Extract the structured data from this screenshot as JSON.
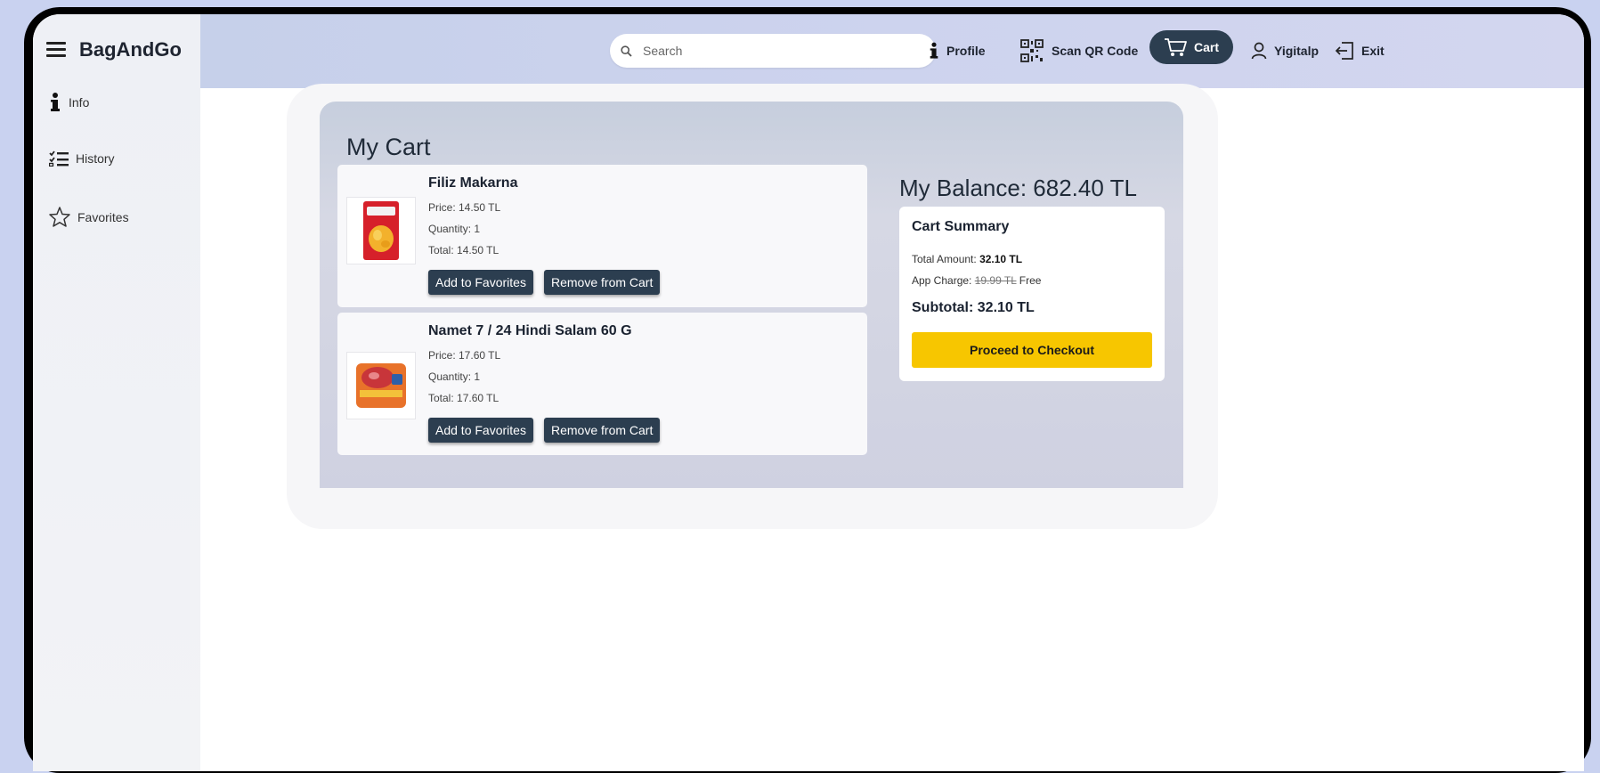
{
  "app": {
    "brand": "BagAndGo"
  },
  "sidebar": {
    "items": [
      {
        "label": "Info"
      },
      {
        "label": "History"
      },
      {
        "label": "Favorites"
      }
    ]
  },
  "topbar": {
    "search_placeholder": "Search",
    "nav": {
      "profile": "Profile",
      "scan": "Scan QR Code",
      "cart": "Cart",
      "user": "Yigitalp",
      "exit": "Exit"
    }
  },
  "cart": {
    "title": "My Cart",
    "items": [
      {
        "name": "Filiz Makarna",
        "price": "Price: 14.50 TL",
        "quantity": "Quantity: 1",
        "total": "Total: 14.50 TL",
        "fav_label": "Add to Favorites",
        "remove_label": "Remove from Cart"
      },
      {
        "name": "Namet 7 / 24 Hindi Salam 60 G",
        "price": "Price: 17.60 TL",
        "quantity": "Quantity: 1",
        "total": "Total: 17.60 TL",
        "fav_label": "Add to Favorites",
        "remove_label": "Remove from Cart"
      }
    ]
  },
  "balance": "My Balance: 682.40 TL",
  "summary": {
    "title": "Cart Summary",
    "total_amount_label": "Total Amount:",
    "total_amount_value": "32.10 TL",
    "app_charge_label": "App Charge:",
    "app_charge_old": "19.99 TL",
    "app_charge_new": "Free",
    "subtotal": "Subtotal: 32.10 TL",
    "checkout_label": "Proceed to Checkout"
  },
  "colors": {
    "accent_dark": "#2c3e50",
    "checkout_yellow": "#f7c600",
    "topbar": "#cdd3ee"
  },
  "icons": [
    "hamburger-icon",
    "info-icon",
    "history-list-icon",
    "star-icon",
    "search-icon",
    "qr-code-icon",
    "cart-icon",
    "user-icon",
    "exit-icon"
  ]
}
